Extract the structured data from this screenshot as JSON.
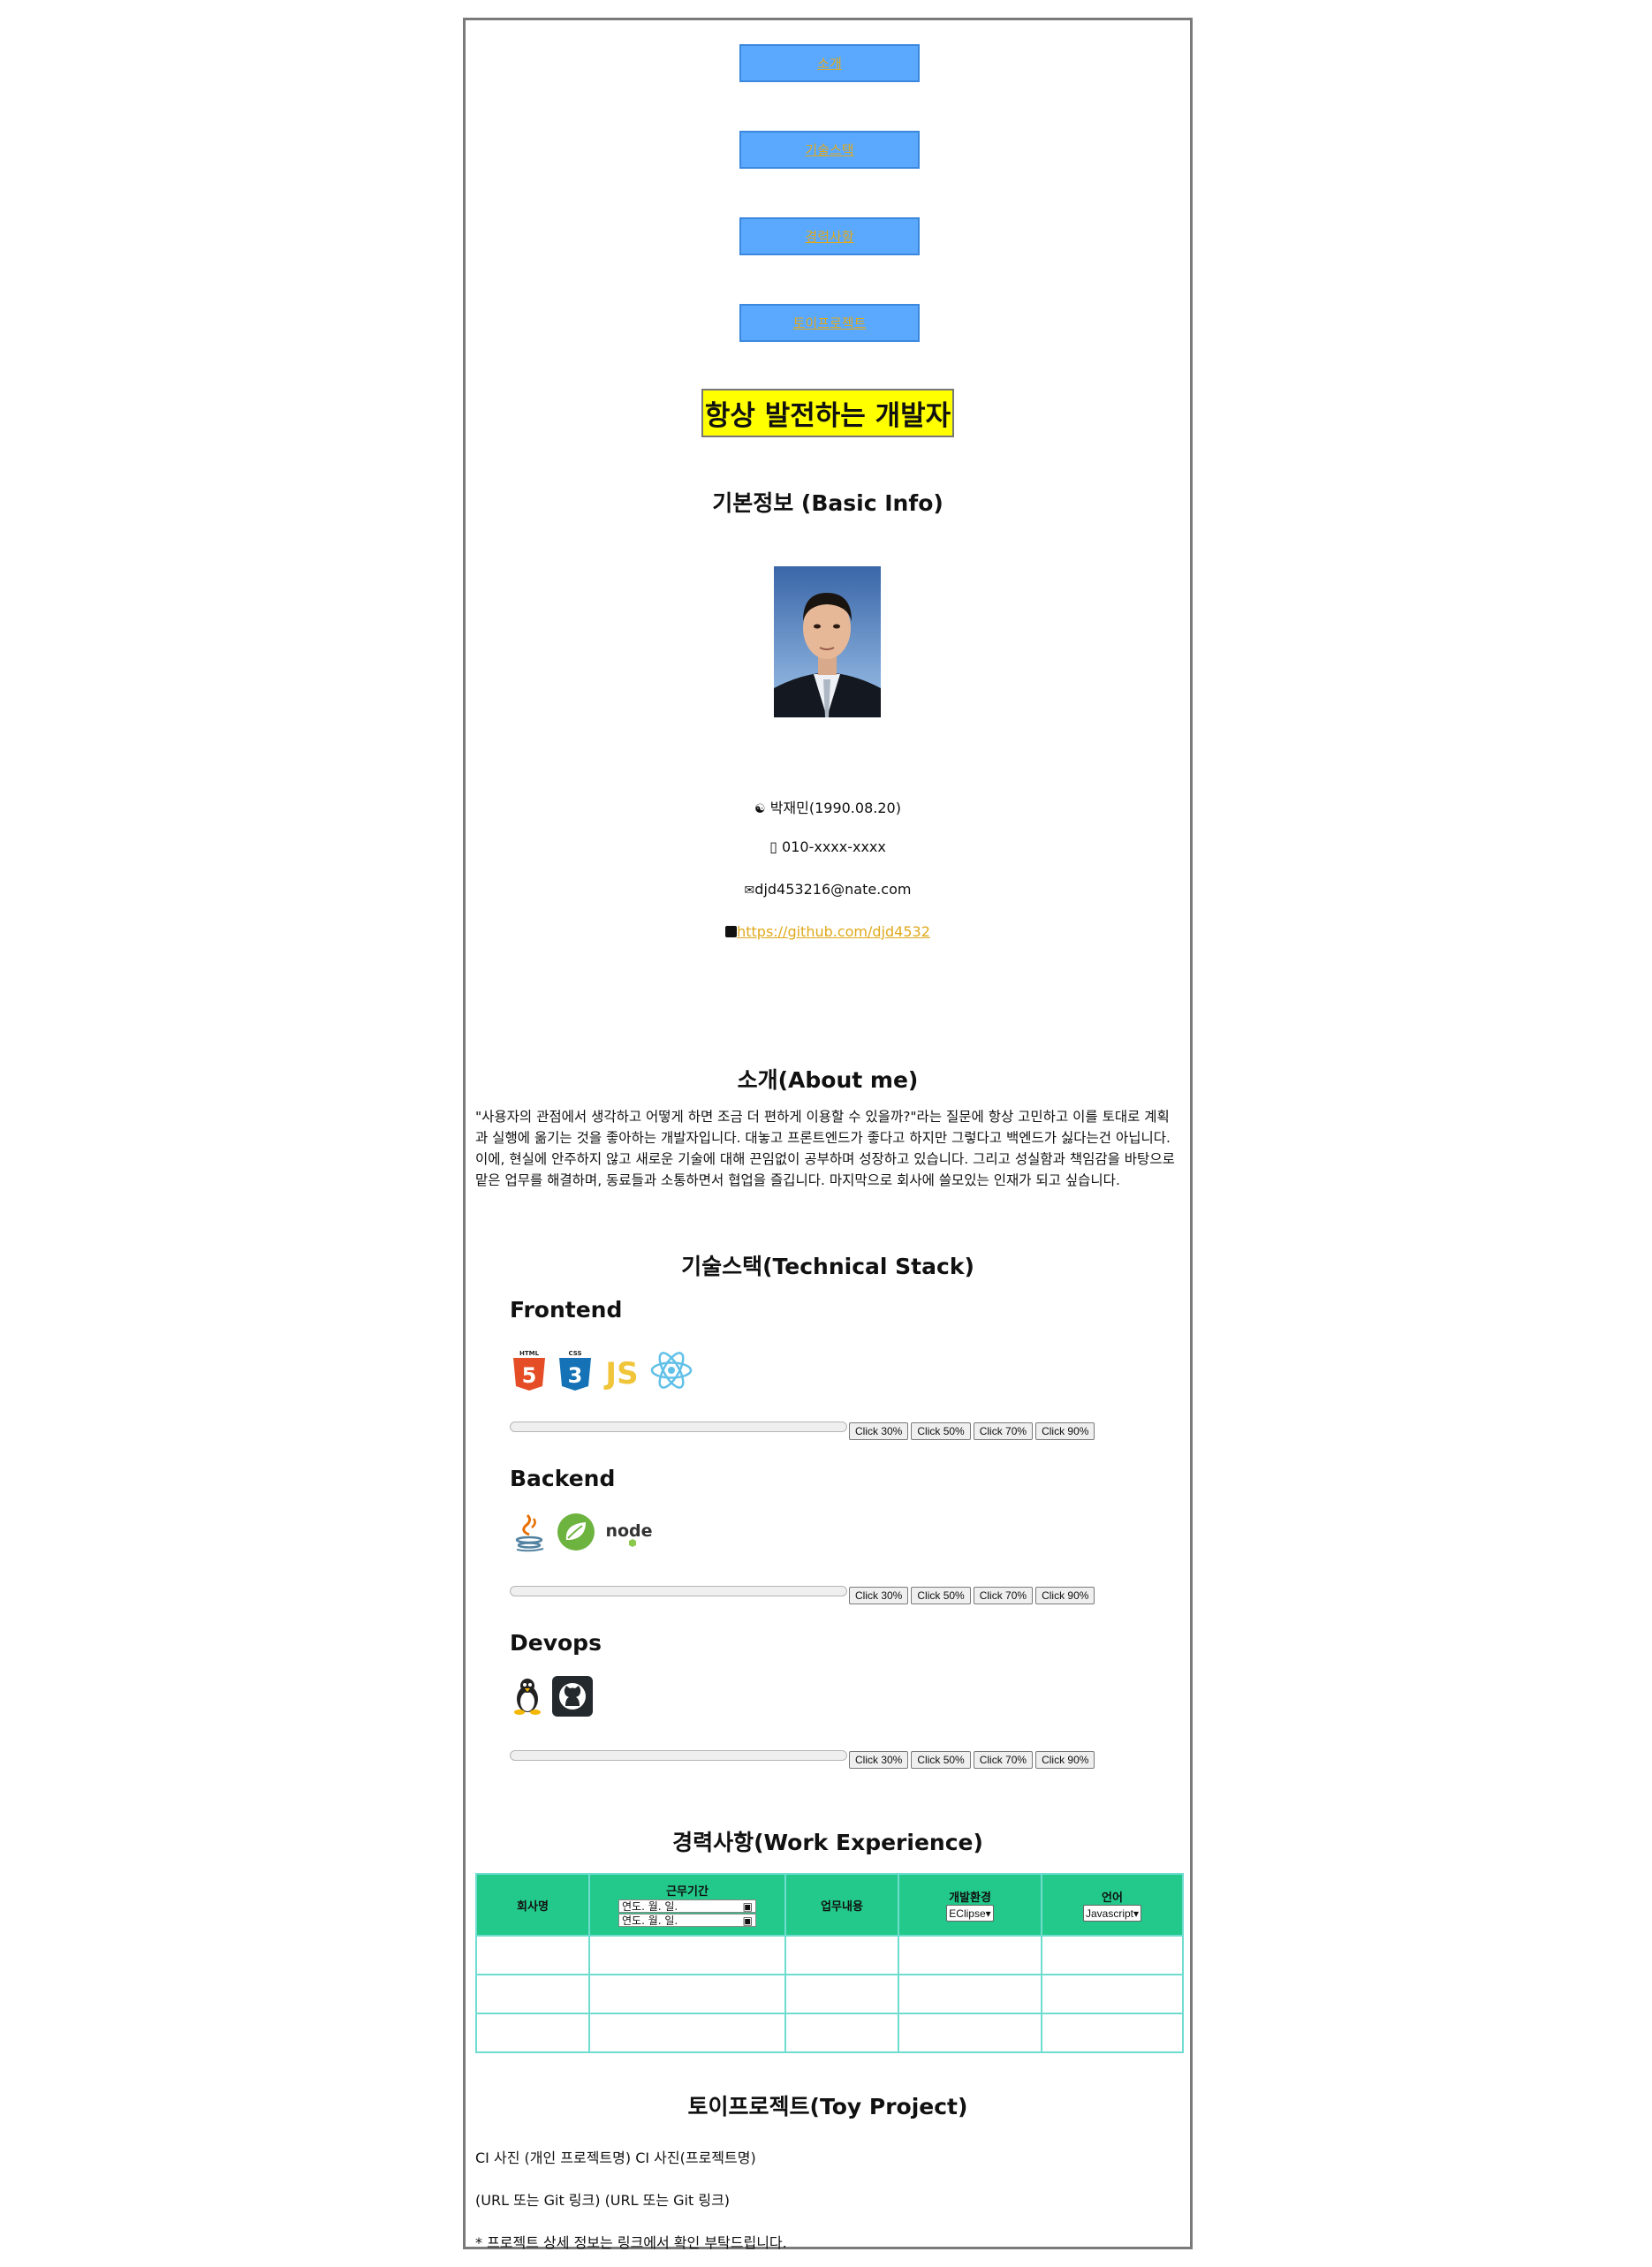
{
  "nav": {
    "items": [
      {
        "label": "소개"
      },
      {
        "label": "기술스택"
      },
      {
        "label": "경력사항"
      },
      {
        "label": "토이프로젝트"
      }
    ]
  },
  "headline": "항상 발전하는 개발자",
  "basic_info": {
    "title": "기본정보 (Basic Info)",
    "name": "박재민(1990.08.20)",
    "phone": "010-xxxx-xxxx",
    "email": "djd453216@nate.com",
    "github": "https://github.com/djd4532"
  },
  "about": {
    "title": "소개(About me)",
    "text": "\"사용자의 관점에서 생각하고 어떻게 하면 조금 더 편하게 이용할 수 있을까?\"라는 질문에 항상 고민하고 이를 토대로 계획과 실행에 옮기는 것을 좋아하는 개발자입니다. 대놓고 프론트엔드가 좋다고 하지만 그렇다고 백엔드가 싫다는건 아닙니다. 이에, 현실에 안주하지 않고 새로운 기술에 대해 끈임없이 공부하며 성장하고 있습니다. 그리고 성실함과 책임감을 바탕으로 맡은 업무를 해결하며, 동료들과 소통하면서 협업을 즐깁니다. 마지막으로 회사에 쓸모있는 인재가 되고 싶습니다."
  },
  "stack": {
    "title": "기술스택(Technical Stack)",
    "buttons": [
      "Click 30%",
      "Click 50%",
      "Click 70%",
      "Click 90%"
    ],
    "sections": [
      {
        "title": "Frontend",
        "icons": [
          "html5-icon",
          "css3-icon",
          "javascript-icon",
          "react-icon"
        ]
      },
      {
        "title": "Backend",
        "icons": [
          "java-icon",
          "spring-icon",
          "nodejs-icon"
        ]
      },
      {
        "title": "Devops",
        "icons": [
          "linux-icon",
          "github-icon"
        ]
      }
    ]
  },
  "work": {
    "title": "경력사항(Work Experience)",
    "headers": [
      "회사명",
      "근무기간",
      "업무내용",
      "개발환경",
      "언어"
    ],
    "date_placeholder": "연도. 월. 일.",
    "env_selected": "EClipse",
    "lang_selected": "Javascript"
  },
  "toy": {
    "title": "토이프로젝트(Toy Project)",
    "line1": "CI 사진 (개인 프로젝트명) CI 사진(프로젝트명)",
    "line2": "(URL 또는 Git 링크) (URL 또는 Git 링크)",
    "note": "* 프로젝트 상세 정보는 링크에서 확인 부탁드립니다."
  },
  "colors": {
    "nav_bg": "#5aa9ff",
    "link": "#e0a91c",
    "headline_bg": "#ffff00",
    "table_header": "#22c98a",
    "table_border": "#6fdcd0"
  }
}
